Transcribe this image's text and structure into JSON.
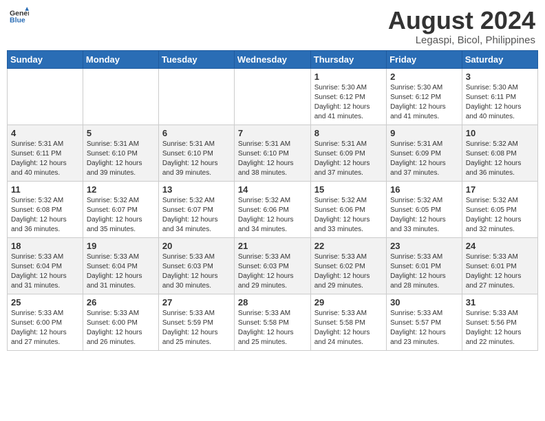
{
  "header": {
    "logo_general": "General",
    "logo_blue": "Blue",
    "main_title": "August 2024",
    "subtitle": "Legaspi, Bicol, Philippines"
  },
  "calendar": {
    "days_of_week": [
      "Sunday",
      "Monday",
      "Tuesday",
      "Wednesday",
      "Thursday",
      "Friday",
      "Saturday"
    ],
    "weeks": [
      [
        {
          "day": "",
          "info": ""
        },
        {
          "day": "",
          "info": ""
        },
        {
          "day": "",
          "info": ""
        },
        {
          "day": "",
          "info": ""
        },
        {
          "day": "1",
          "info": "Sunrise: 5:30 AM\nSunset: 6:12 PM\nDaylight: 12 hours\nand 41 minutes."
        },
        {
          "day": "2",
          "info": "Sunrise: 5:30 AM\nSunset: 6:12 PM\nDaylight: 12 hours\nand 41 minutes."
        },
        {
          "day": "3",
          "info": "Sunrise: 5:30 AM\nSunset: 6:11 PM\nDaylight: 12 hours\nand 40 minutes."
        }
      ],
      [
        {
          "day": "4",
          "info": "Sunrise: 5:31 AM\nSunset: 6:11 PM\nDaylight: 12 hours\nand 40 minutes."
        },
        {
          "day": "5",
          "info": "Sunrise: 5:31 AM\nSunset: 6:10 PM\nDaylight: 12 hours\nand 39 minutes."
        },
        {
          "day": "6",
          "info": "Sunrise: 5:31 AM\nSunset: 6:10 PM\nDaylight: 12 hours\nand 39 minutes."
        },
        {
          "day": "7",
          "info": "Sunrise: 5:31 AM\nSunset: 6:10 PM\nDaylight: 12 hours\nand 38 minutes."
        },
        {
          "day": "8",
          "info": "Sunrise: 5:31 AM\nSunset: 6:09 PM\nDaylight: 12 hours\nand 37 minutes."
        },
        {
          "day": "9",
          "info": "Sunrise: 5:31 AM\nSunset: 6:09 PM\nDaylight: 12 hours\nand 37 minutes."
        },
        {
          "day": "10",
          "info": "Sunrise: 5:32 AM\nSunset: 6:08 PM\nDaylight: 12 hours\nand 36 minutes."
        }
      ],
      [
        {
          "day": "11",
          "info": "Sunrise: 5:32 AM\nSunset: 6:08 PM\nDaylight: 12 hours\nand 36 minutes."
        },
        {
          "day": "12",
          "info": "Sunrise: 5:32 AM\nSunset: 6:07 PM\nDaylight: 12 hours\nand 35 minutes."
        },
        {
          "day": "13",
          "info": "Sunrise: 5:32 AM\nSunset: 6:07 PM\nDaylight: 12 hours\nand 34 minutes."
        },
        {
          "day": "14",
          "info": "Sunrise: 5:32 AM\nSunset: 6:06 PM\nDaylight: 12 hours\nand 34 minutes."
        },
        {
          "day": "15",
          "info": "Sunrise: 5:32 AM\nSunset: 6:06 PM\nDaylight: 12 hours\nand 33 minutes."
        },
        {
          "day": "16",
          "info": "Sunrise: 5:32 AM\nSunset: 6:05 PM\nDaylight: 12 hours\nand 33 minutes."
        },
        {
          "day": "17",
          "info": "Sunrise: 5:32 AM\nSunset: 6:05 PM\nDaylight: 12 hours\nand 32 minutes."
        }
      ],
      [
        {
          "day": "18",
          "info": "Sunrise: 5:33 AM\nSunset: 6:04 PM\nDaylight: 12 hours\nand 31 minutes."
        },
        {
          "day": "19",
          "info": "Sunrise: 5:33 AM\nSunset: 6:04 PM\nDaylight: 12 hours\nand 31 minutes."
        },
        {
          "day": "20",
          "info": "Sunrise: 5:33 AM\nSunset: 6:03 PM\nDaylight: 12 hours\nand 30 minutes."
        },
        {
          "day": "21",
          "info": "Sunrise: 5:33 AM\nSunset: 6:03 PM\nDaylight: 12 hours\nand 29 minutes."
        },
        {
          "day": "22",
          "info": "Sunrise: 5:33 AM\nSunset: 6:02 PM\nDaylight: 12 hours\nand 29 minutes."
        },
        {
          "day": "23",
          "info": "Sunrise: 5:33 AM\nSunset: 6:01 PM\nDaylight: 12 hours\nand 28 minutes."
        },
        {
          "day": "24",
          "info": "Sunrise: 5:33 AM\nSunset: 6:01 PM\nDaylight: 12 hours\nand 27 minutes."
        }
      ],
      [
        {
          "day": "25",
          "info": "Sunrise: 5:33 AM\nSunset: 6:00 PM\nDaylight: 12 hours\nand 27 minutes."
        },
        {
          "day": "26",
          "info": "Sunrise: 5:33 AM\nSunset: 6:00 PM\nDaylight: 12 hours\nand 26 minutes."
        },
        {
          "day": "27",
          "info": "Sunrise: 5:33 AM\nSunset: 5:59 PM\nDaylight: 12 hours\nand 25 minutes."
        },
        {
          "day": "28",
          "info": "Sunrise: 5:33 AM\nSunset: 5:58 PM\nDaylight: 12 hours\nand 25 minutes."
        },
        {
          "day": "29",
          "info": "Sunrise: 5:33 AM\nSunset: 5:58 PM\nDaylight: 12 hours\nand 24 minutes."
        },
        {
          "day": "30",
          "info": "Sunrise: 5:33 AM\nSunset: 5:57 PM\nDaylight: 12 hours\nand 23 minutes."
        },
        {
          "day": "31",
          "info": "Sunrise: 5:33 AM\nSunset: 5:56 PM\nDaylight: 12 hours\nand 22 minutes."
        }
      ]
    ]
  }
}
